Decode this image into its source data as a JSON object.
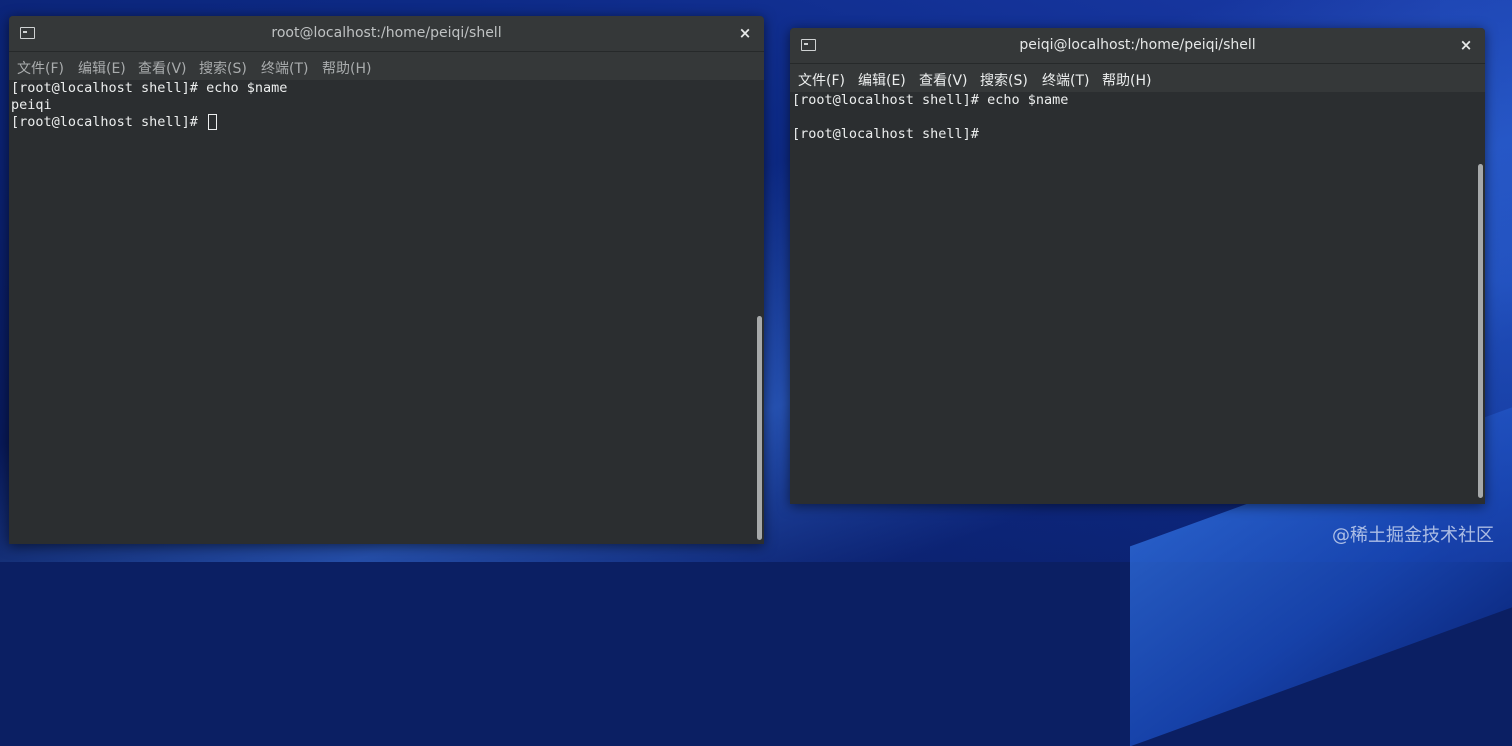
{
  "windows": [
    {
      "title": "root@localhost:/home/peiqi/shell",
      "close_label": "×",
      "menu": [
        "文件(F)",
        "编辑(E)",
        "查看(V)",
        "搜索(S)",
        "终端(T)",
        "帮助(H)"
      ],
      "terminal_lines": [
        "[root@localhost shell]# echo $name",
        "peiqi",
        "[root@localhost shell]# "
      ]
    },
    {
      "title": "peiqi@localhost:/home/peiqi/shell",
      "close_label": "×",
      "menu": [
        "文件(F)",
        "编辑(E)",
        "查看(V)",
        "搜索(S)",
        "终端(T)",
        "帮助(H)"
      ],
      "terminal_lines": [
        "[root@localhost shell]# echo $name",
        "",
        "[root@localhost shell]#"
      ]
    }
  ],
  "watermark": "@稀土掘金技术社区"
}
